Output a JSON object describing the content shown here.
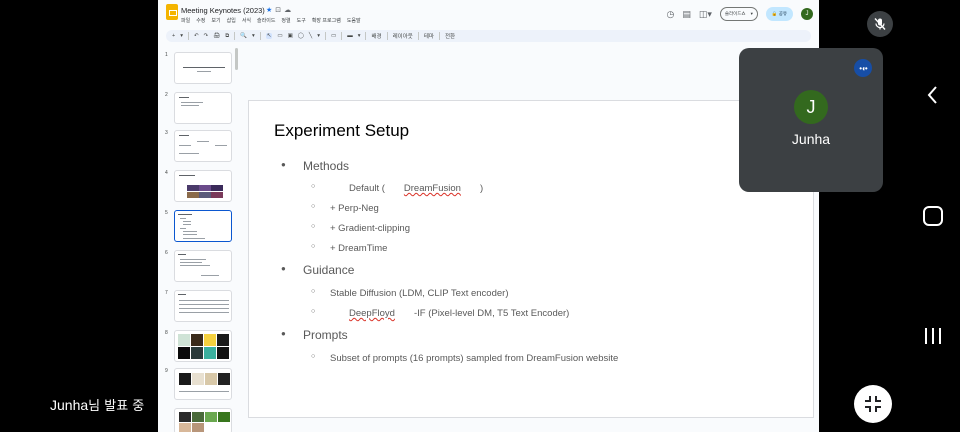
{
  "doc": {
    "title": "Meeting Keynotes (2023)",
    "menus": [
      "파일",
      "수정",
      "보기",
      "삽입",
      "서식",
      "슬라이드",
      "정렬",
      "도구",
      "확장 프로그램",
      "도움말"
    ],
    "slideshow_label": "슬라이드쇼",
    "share_label": "공유",
    "user_initial": "J"
  },
  "toolbar": {
    "items": [
      "+",
      "▾",
      "↶",
      "↷",
      "🖨",
      "⧉",
      "🔍",
      "▾",
      "↖",
      "▭",
      "▣",
      "◯",
      "╲",
      "▾",
      "▭",
      "▬",
      "▾"
    ],
    "background_label": "배경",
    "layout_label": "레이아웃",
    "theme_label": "테마",
    "transition_label": "전환"
  },
  "filmstrip": {
    "numbers": [
      "1",
      "2",
      "3",
      "4",
      "5",
      "6",
      "7",
      "8",
      "9"
    ],
    "active": 5
  },
  "slide": {
    "title": "Experiment Setup",
    "methods": "Methods",
    "m1_prefix": "Default (",
    "m1_link": "DreamFusion",
    "m1_suffix": ")",
    "m2": "+ Perp-Neg",
    "m3": "+ Gradient-clipping",
    "m4": "+ DreamTime",
    "guidance": "Guidance",
    "g1": "Stable Diffusion (LDM, CLIP Text encoder)",
    "g2_link": "DeepFloyd",
    "g2_suffix": "-IF (Pixel-level DM, T5 Text Encoder)",
    "prompts": "Prompts",
    "p1": "Subset of prompts (16 prompts) sampled from DreamFusion website"
  },
  "participant": {
    "initial": "J",
    "name": "Junha",
    "avatar_color": "#33691e"
  },
  "presenting_label_name": "Junha",
  "presenting_label_suffix": "님 발표 중"
}
